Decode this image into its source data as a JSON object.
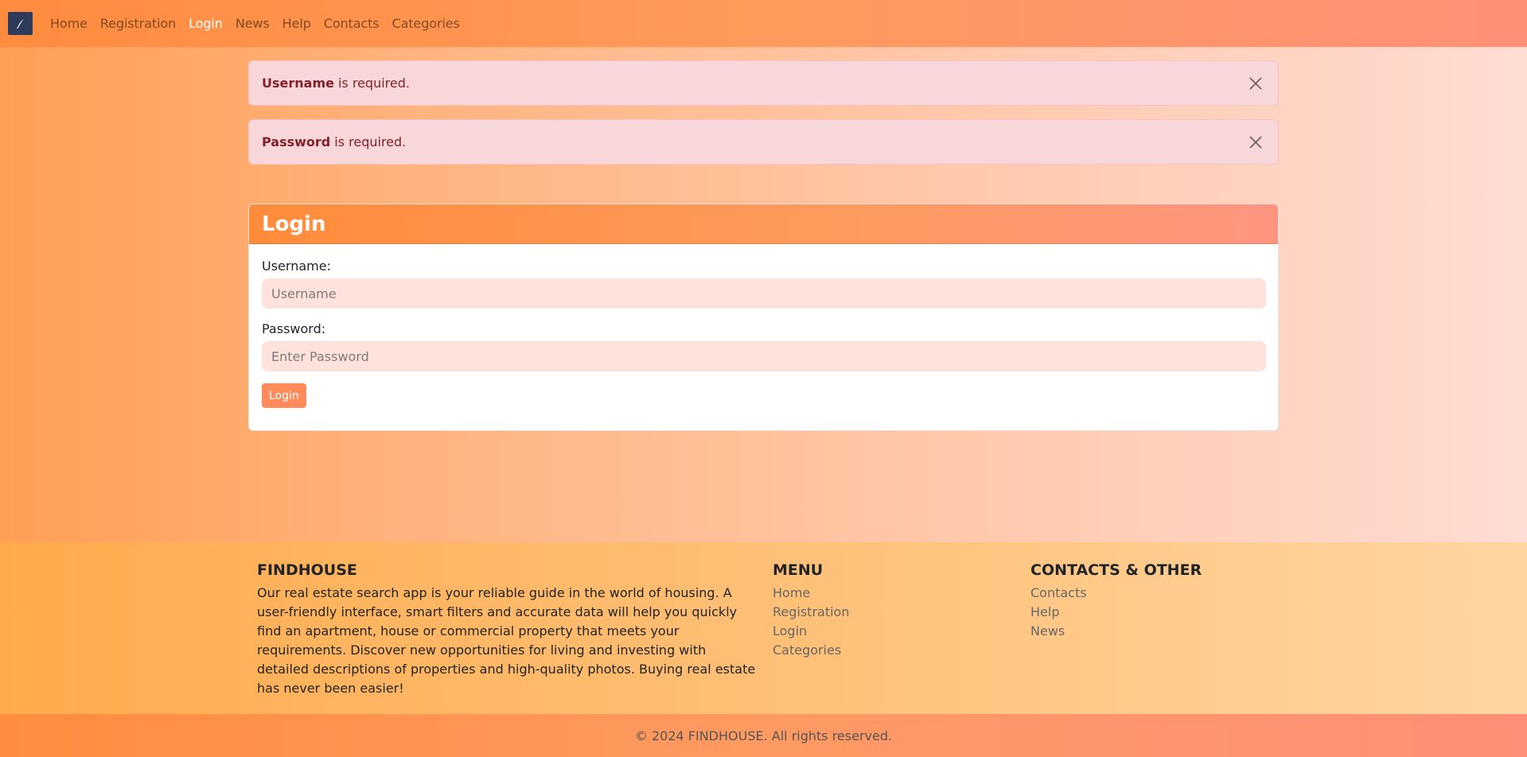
{
  "nav": {
    "items": [
      {
        "label": "Home",
        "active": false
      },
      {
        "label": "Registration",
        "active": false
      },
      {
        "label": "Login",
        "active": true
      },
      {
        "label": "News",
        "active": false
      },
      {
        "label": "Help",
        "active": false
      },
      {
        "label": "Contacts",
        "active": false
      },
      {
        "label": "Categories",
        "active": false
      }
    ]
  },
  "alerts": [
    {
      "field": "Username",
      "message": "is required."
    },
    {
      "field": "Password",
      "message": "is required."
    }
  ],
  "login_card": {
    "title": "Login",
    "username_label": "Username:",
    "username_placeholder": "Username",
    "username_value": "",
    "password_label": "Password:",
    "password_placeholder": "Enter Password",
    "password_value": "",
    "submit_label": "Login"
  },
  "footer": {
    "about": {
      "heading": "FINDHOUSE",
      "text": "Our real estate search app is your reliable guide in the world of housing. A user-friendly interface, smart filters and accurate data will help you quickly find an apartment, house or commercial property that meets your requirements. Discover new opportunities for living and investing with detailed descriptions of properties and high-quality photos. Buying real estate has never been easier!"
    },
    "menu": {
      "heading": "MENU",
      "links": [
        "Home",
        "Registration",
        "Login",
        "Categories"
      ]
    },
    "contacts": {
      "heading": "CONTACTS & OTHER",
      "links": [
        "Contacts",
        "Help",
        "News"
      ]
    },
    "copyright": "© 2024 FINDHOUSE. All rights reserved."
  },
  "colors": {
    "accent": "#ff8b5a",
    "alert_bg": "#f8d7da",
    "alert_text": "#842029",
    "input_bg": "#ffe2dc"
  },
  "icons": {
    "brand": "quill-icon",
    "alert_close": "close-icon"
  }
}
